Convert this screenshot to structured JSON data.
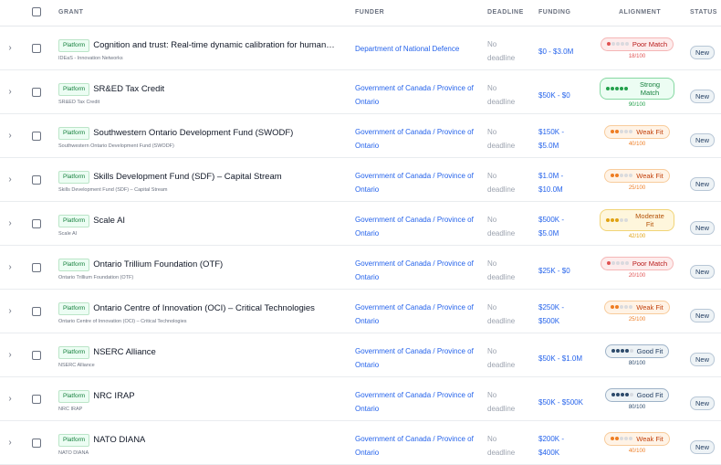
{
  "header": {
    "grant": "GRANT",
    "funder": "FUNDER",
    "deadline": "DEADLINE",
    "funding": "FUNDING",
    "alignment": "ALIGNMENT",
    "status": "STATUS"
  },
  "colors": {
    "poor": "#e05252",
    "strong": "#22a04b",
    "weak": "#ee7d23",
    "moderate": "#e0a213",
    "good": "#2d4a6b",
    "link": "#2563eb"
  },
  "rows": [
    {
      "badge": "Platform",
      "name": "Cognition and trust: Real-time dynamic calibration for human-...",
      "sub": "IDEaS - Innovation Networks",
      "funder": "Department of National Defence",
      "deadline": [
        "No",
        "deadline"
      ],
      "funding": [
        "$0 - $3.0M"
      ],
      "alignment": {
        "label": "Poor Match",
        "level": "poor",
        "filled": 1,
        "score": "18/100"
      },
      "status": "New"
    },
    {
      "badge": "Platform",
      "name": "SR&ED Tax Credit",
      "sub": "SR&ED Tax Credit",
      "funder": "Government of Canada / Province of Ontario",
      "deadline": [
        "No",
        "deadline"
      ],
      "funding": [
        "$50K - $0"
      ],
      "alignment": {
        "label": "Strong Match",
        "level": "strong",
        "filled": 5,
        "score": "90/100"
      },
      "status": "New"
    },
    {
      "badge": "Platform",
      "name": "Southwestern Ontario Development Fund (SWODF)",
      "sub": "Southwestern Ontario Development Fund (SWODF)",
      "funder": "Government of Canada / Province of Ontario",
      "deadline": [
        "No",
        "deadline"
      ],
      "funding": [
        "$150K -",
        "$5.0M"
      ],
      "alignment": {
        "label": "Weak Fit",
        "level": "weak",
        "filled": 2,
        "score": "40/100"
      },
      "status": "New"
    },
    {
      "badge": "Platform",
      "name": "Skills Development Fund (SDF) – Capital Stream",
      "sub": "Skills Development Fund (SDF) – Capital Stream",
      "funder": "Government of Canada / Province of Ontario",
      "deadline": [
        "No",
        "deadline"
      ],
      "funding": [
        "$1.0M -",
        "$10.0M"
      ],
      "alignment": {
        "label": "Weak Fit",
        "level": "weak",
        "filled": 2,
        "score": "25/100"
      },
      "status": "New"
    },
    {
      "badge": "Platform",
      "name": "Scale AI",
      "sub": "Scale AI",
      "funder": "Government of Canada / Province of Ontario",
      "deadline": [
        "No",
        "deadline"
      ],
      "funding": [
        "$500K -",
        "$5.0M"
      ],
      "alignment": {
        "label": "Moderate Fit",
        "level": "moderate",
        "filled": 3,
        "score": "42/100"
      },
      "status": "New"
    },
    {
      "badge": "Platform",
      "name": "Ontario Trillium Foundation (OTF)",
      "sub": "Ontario Trillium Foundation (OTF)",
      "funder": "Government of Canada / Province of Ontario",
      "deadline": [
        "No",
        "deadline"
      ],
      "funding": [
        "$25K - $0"
      ],
      "alignment": {
        "label": "Poor Match",
        "level": "poor",
        "filled": 1,
        "score": "20/100"
      },
      "status": "New"
    },
    {
      "badge": "Platform",
      "name": "Ontario Centre of Innovation (OCI) – Critical Technologies",
      "sub": "Ontario Centre of Innovation (OCI) – Critical Technologies",
      "funder": "Government of Canada / Province of Ontario",
      "deadline": [
        "No",
        "deadline"
      ],
      "funding": [
        "$250K -",
        "$500K"
      ],
      "alignment": {
        "label": "Weak Fit",
        "level": "weak",
        "filled": 2,
        "score": "25/100"
      },
      "status": "New"
    },
    {
      "badge": "Platform",
      "name": "NSERC Alliance",
      "sub": "NSERC Alliance",
      "funder": "Government of Canada / Province of Ontario",
      "deadline": [
        "No",
        "deadline"
      ],
      "funding": [
        "$50K - $1.0M"
      ],
      "alignment": {
        "label": "Good Fit",
        "level": "good",
        "filled": 4,
        "score": "80/100"
      },
      "status": "New"
    },
    {
      "badge": "Platform",
      "name": "NRC IRAP",
      "sub": "NRC IRAP",
      "funder": "Government of Canada / Province of Ontario",
      "deadline": [
        "No",
        "deadline"
      ],
      "funding": [
        "$50K - $500K"
      ],
      "alignment": {
        "label": "Good Fit",
        "level": "good",
        "filled": 4,
        "score": "80/100"
      },
      "status": "New"
    },
    {
      "badge": "Platform",
      "name": "NATO DIANA",
      "sub": "NATO DIANA",
      "funder": "Government of Canada / Province of Ontario",
      "deadline": [
        "No",
        "deadline"
      ],
      "funding": [
        "$200K -",
        "$400K"
      ],
      "alignment": {
        "label": "Weak Fit",
        "level": "weak",
        "filled": 2,
        "score": "40/100"
      },
      "status": "New"
    }
  ]
}
